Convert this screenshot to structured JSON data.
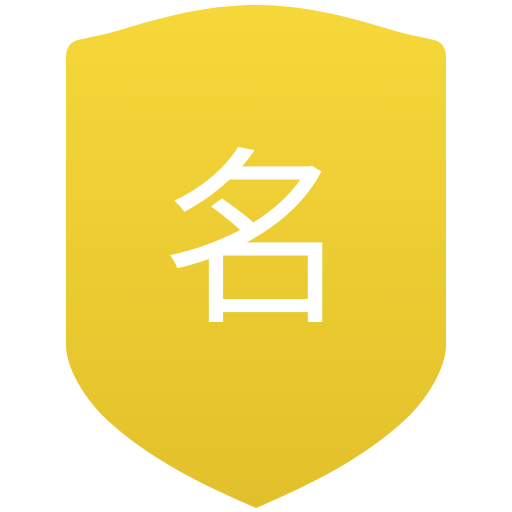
{
  "badge": {
    "character": "名",
    "colors": {
      "top": "#F6D83A",
      "bottom": "#E2C02B",
      "glyph": "#FFFFFF"
    },
    "icon": "shield-icon"
  }
}
